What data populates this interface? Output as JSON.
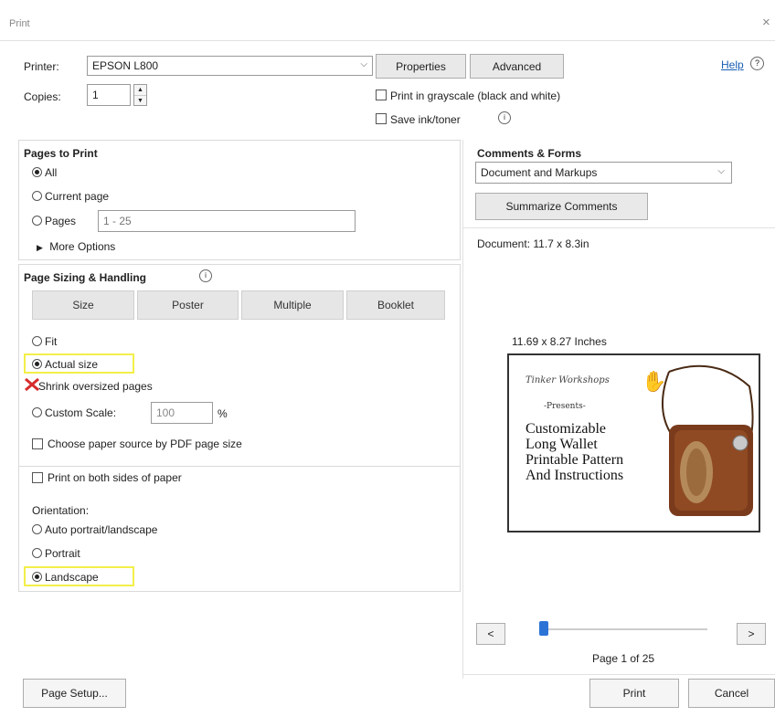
{
  "window": {
    "title": "Print",
    "close_glyph": "×"
  },
  "top": {
    "printer_label": "Printer:",
    "printer_value": "EPSON L800",
    "copies_label": "Copies:",
    "copies_value": "1",
    "properties_label": "Properties",
    "advanced_label": "Advanced",
    "help_label": "Help",
    "grayscale_label": "Print in grayscale (black and white)",
    "save_ink_label": "Save ink/toner",
    "grayscale_checked": false,
    "save_ink_checked": false
  },
  "pages": {
    "title": "Pages to Print",
    "all": "All",
    "current": "Current page",
    "pages_label": "Pages",
    "pages_value": "1 - 25",
    "more_options": "More Options",
    "selected": "all"
  },
  "sizing": {
    "title": "Page Sizing & Handling",
    "tabs": [
      "Size",
      "Poster",
      "Multiple",
      "Booklet"
    ],
    "fit": "Fit",
    "actual": "Actual size",
    "shrink": "Shrink oversized pages",
    "custom": "Custom Scale:",
    "custom_value": "100",
    "percent": "%",
    "paper_source": "Choose paper source by PDF page size",
    "selected": "actual"
  },
  "duplex": {
    "label": "Print on both sides of paper",
    "checked": false
  },
  "orientation": {
    "title": "Orientation:",
    "auto": "Auto portrait/landscape",
    "portrait": "Portrait",
    "landscape": "Landscape",
    "selected": "landscape"
  },
  "comments": {
    "title": "Comments & Forms",
    "value": "Document and Markups",
    "summarize": "Summarize Comments",
    "document_size": "Document: 11.7 x 8.3in"
  },
  "preview": {
    "size_label": "11.69 x 8.27 Inches",
    "brand": "Tinker Workshops",
    "presents": "-Presents-",
    "lines": [
      "Customizable",
      "Long Wallet",
      "Printable Pattern",
      "And Instructions"
    ],
    "page_info": "Page 1 of 25",
    "slider_position": 0
  },
  "footer": {
    "page_setup": "Page Setup...",
    "print": "Print",
    "cancel": "Cancel"
  },
  "colors": {
    "highlight": "#f2ef4a",
    "accent": "#2b74d6",
    "strike": "#d62c2c"
  }
}
